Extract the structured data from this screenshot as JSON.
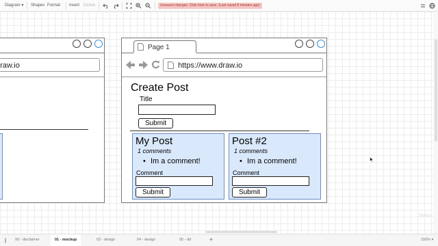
{
  "toolbar": {
    "diagram_menu": "Diagram",
    "shapes": "Shapes",
    "format": "Format",
    "insert": "Insert",
    "delete": "Delete",
    "unsaved_message": "Unsaved changes. Click here to save. (Last saved 8 minutes ago)"
  },
  "left_frame": {
    "url": "draw.io"
  },
  "main_frame": {
    "tab_label": "Page 1",
    "url": "https://www.draw.io",
    "heading": "Create Post",
    "title_label": "Title",
    "submit_label": "Submit",
    "posts": [
      {
        "title": "My Post",
        "comments": "1 comments",
        "comment": "Im a comment!",
        "comment_label": "Comment",
        "submit_label": "Submit"
      },
      {
        "title": "Post #2",
        "comments": "1 comments",
        "comment": "Im a comment!",
        "comment_label": "Comment",
        "submit_label": "Submit"
      }
    ]
  },
  "watermark": "Sketch",
  "page_tabs": [
    "00 - disclaimer",
    "01 - mockup",
    "03 - design",
    "04 - design",
    "05 - dd"
  ],
  "active_tab_index": 1,
  "zoom": "150%",
  "colors": {
    "post_fill": "#dae8fc",
    "post_border": "#6c8ebf",
    "unsaved_bg": "#f4c7c3"
  }
}
